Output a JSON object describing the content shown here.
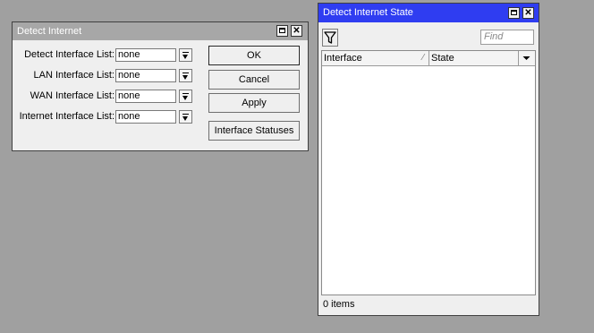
{
  "detect_dialog": {
    "title": "Detect Internet",
    "fields": [
      {
        "label": "Detect Interface List:",
        "value": "none"
      },
      {
        "label": "LAN Interface List:",
        "value": "none"
      },
      {
        "label": "WAN Interface List:",
        "value": "none"
      },
      {
        "label": "Internet Interface List:",
        "value": "none"
      }
    ],
    "buttons": {
      "ok": "OK",
      "cancel": "Cancel",
      "apply": "Apply",
      "statuses": "Interface Statuses"
    }
  },
  "state_window": {
    "title": "Detect Internet State",
    "find_placeholder": "Find",
    "columns": [
      "Interface",
      "State"
    ],
    "rows": [],
    "status": "0 items"
  },
  "colors": {
    "desktop": "#a0a0a0",
    "inactive_title": "#a7a7a7",
    "active_title": "#2f3df1"
  },
  "icons": [
    "maximize-icon",
    "close-icon",
    "dropdown-arrow-icon",
    "filter-icon",
    "sort-indicator-icon",
    "column-menu-icon"
  ]
}
